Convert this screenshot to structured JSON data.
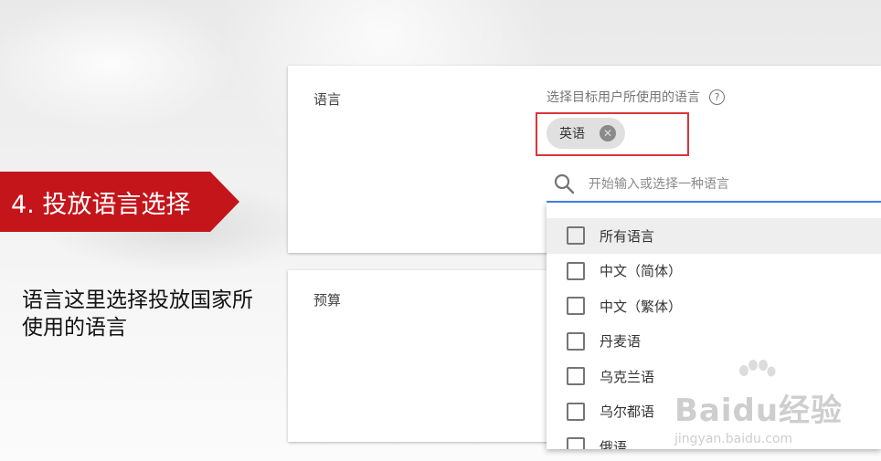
{
  "slide": {
    "step_label": "4. 投放语言选择",
    "description": "语言这里选择投放国家所使用的语言"
  },
  "language_section": {
    "title": "语言",
    "hint": "选择目标用户所使用的语言",
    "help_icon": "help-circle-icon",
    "selected_chip": "英语",
    "search_placeholder": "开始输入或选择一种语言",
    "options": [
      "所有语言",
      "中文（简体）",
      "中文（繁体）",
      "丹麦语",
      "乌克兰语",
      "乌尔都语",
      "俄语"
    ]
  },
  "budget_section": {
    "title": "预算"
  },
  "watermark": {
    "logo": "Baidu经验",
    "url": "jingyan.baidu.com"
  },
  "colors": {
    "accent_red": "#c4151b",
    "highlight": "#d9363b",
    "focus_blue": "#4285f4"
  }
}
